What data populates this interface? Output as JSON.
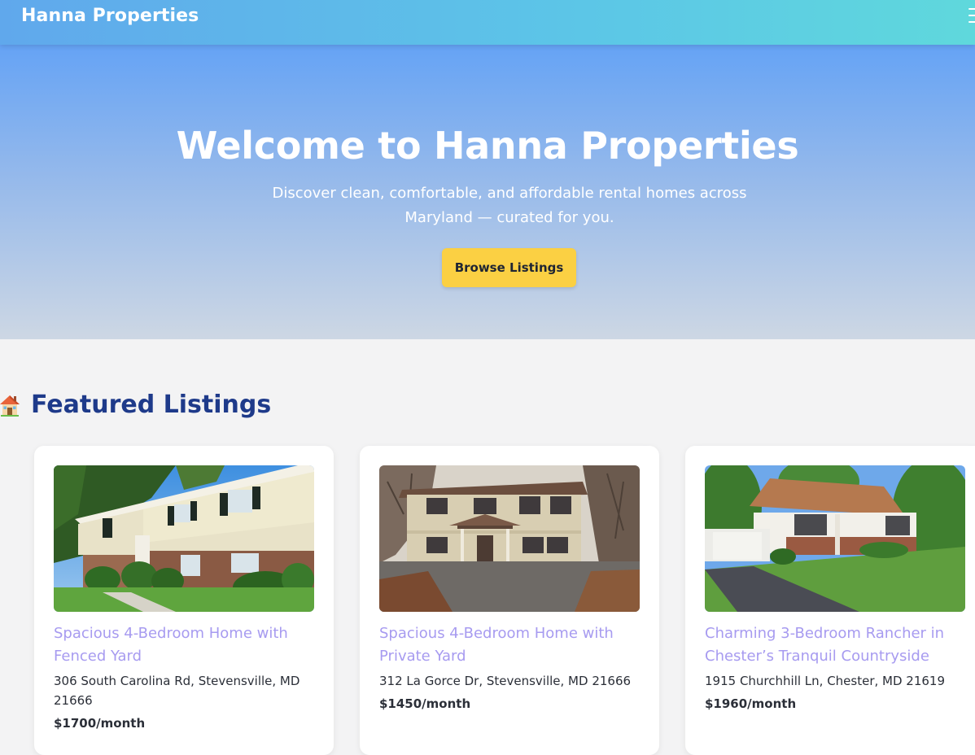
{
  "nav": {
    "brand": "Hanna Properties",
    "menu_icon": "hamburger-menu-icon"
  },
  "hero": {
    "title": "Welcome to Hanna Properties",
    "subtitle": "Discover clean, comfortable, and affordable rental homes across Maryland — curated for you.",
    "button_label": "Browse Listings"
  },
  "featured": {
    "heading": "Featured Listings",
    "icon": "house-icon",
    "listings": [
      {
        "title": "Spacious 4-Bedroom Home with Fenced Yard",
        "address": "306 South Carolina Rd, Stevensville, MD 21666",
        "price": "$1700/month"
      },
      {
        "title": "Spacious 4-Bedroom Home with Private Yard",
        "address": "312 La Gorce Dr, Stevensville, MD 21666",
        "price": "$1450/month"
      },
      {
        "title": "Charming 3-Bedroom Rancher in Chester’s Tranquil Countryside",
        "address": "1915 Churchhill Ln, Chester, MD 21619",
        "price": "$1960/month"
      }
    ]
  },
  "colors": {
    "nav_gradient_start": "#60a8ec",
    "nav_gradient_end": "#5fd8dc",
    "hero_top": "#65a3f5",
    "hero_bottom": "#cdd7e4",
    "button": "#fbd043",
    "heading": "#1e3a8a",
    "listing_title": "#a79bf0"
  }
}
